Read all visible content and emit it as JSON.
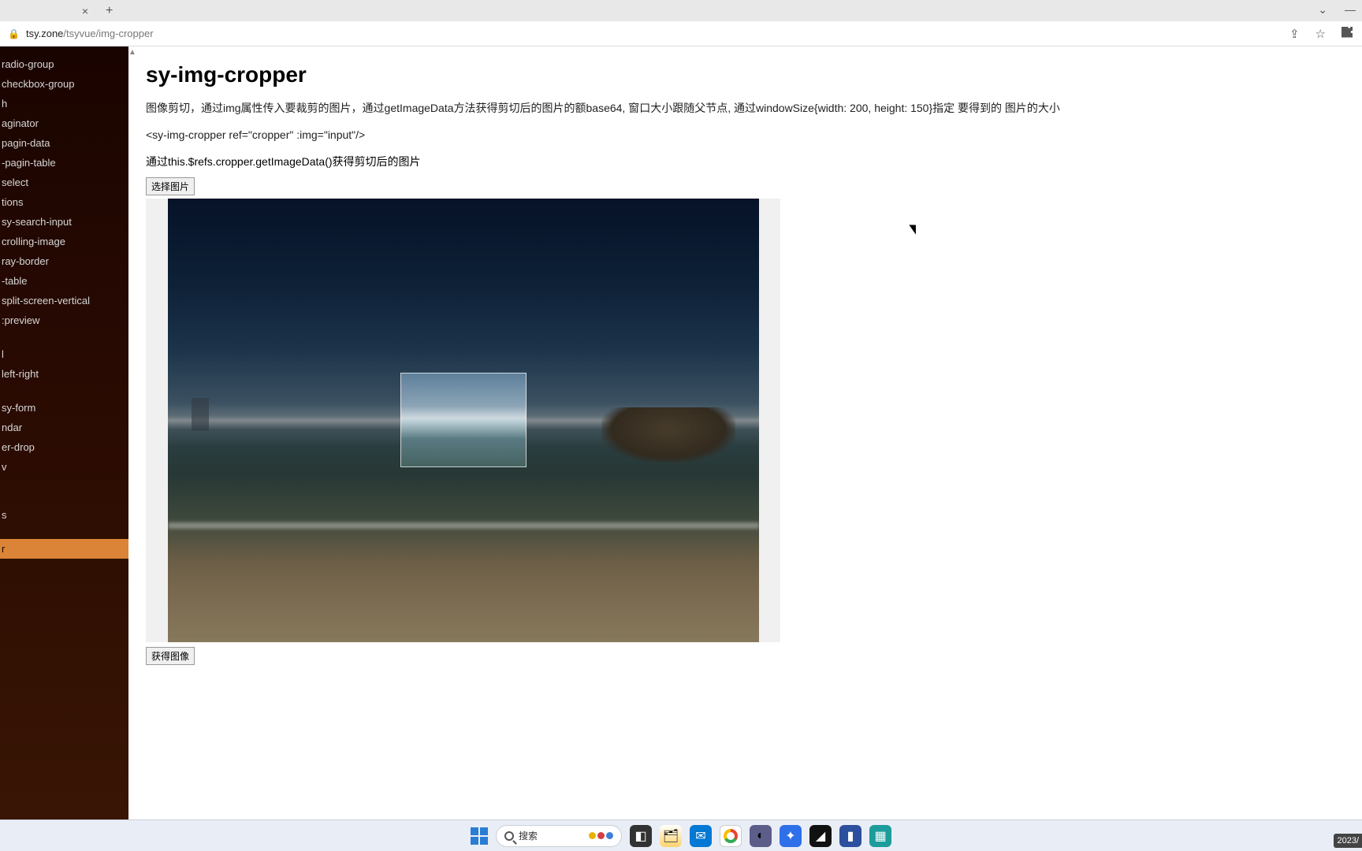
{
  "browser": {
    "url_host": "tsy.zone",
    "url_path": "/tsyvue/img-cropper"
  },
  "sidebar": {
    "items": [
      {
        "label": "radio-group"
      },
      {
        "label": "checkbox-group"
      },
      {
        "label": "h"
      },
      {
        "label": "aginator"
      },
      {
        "label": "pagin-data"
      },
      {
        "label": "-pagin-table"
      },
      {
        "label": "select"
      },
      {
        "label": "tions"
      },
      {
        "label": "sy-search-input"
      },
      {
        "label": "crolling-image"
      },
      {
        "label": "ray-border"
      },
      {
        "label": "-table"
      },
      {
        "label": "split-screen-vertical"
      },
      {
        "label": ":preview"
      },
      {
        "label": "",
        "sep": true
      },
      {
        "label": "l"
      },
      {
        "label": "left-right"
      },
      {
        "label": "",
        "sep": true
      },
      {
        "label": "sy-form"
      },
      {
        "label": "ndar"
      },
      {
        "label": "er-drop"
      },
      {
        "label": "v"
      },
      {
        "label": "",
        "sep": true
      },
      {
        "label": "",
        "sep": true
      },
      {
        "label": "s"
      },
      {
        "label": "",
        "sep": true
      },
      {
        "label": "r",
        "active": true
      }
    ]
  },
  "main": {
    "title": "sy-img-cropper",
    "desc": "图像剪切，通过img属性传入要裁剪的图片，通过getImageData方法获得剪切后的图片的额base64, 窗口大小跟随父节点, 通过windowSize{width: 200, height: 150}指定 要得到的 图片的大小",
    "code": "<sy-img-cropper ref=\"cropper\" :img=\"input\"/>",
    "method_line": "通过this.$refs.cropper.getImageData()获得剪切后的图片",
    "select_btn": "选择图片",
    "get_btn": "获得图像"
  },
  "taskbar": {
    "search_placeholder": "搜索",
    "date": "2023/"
  }
}
